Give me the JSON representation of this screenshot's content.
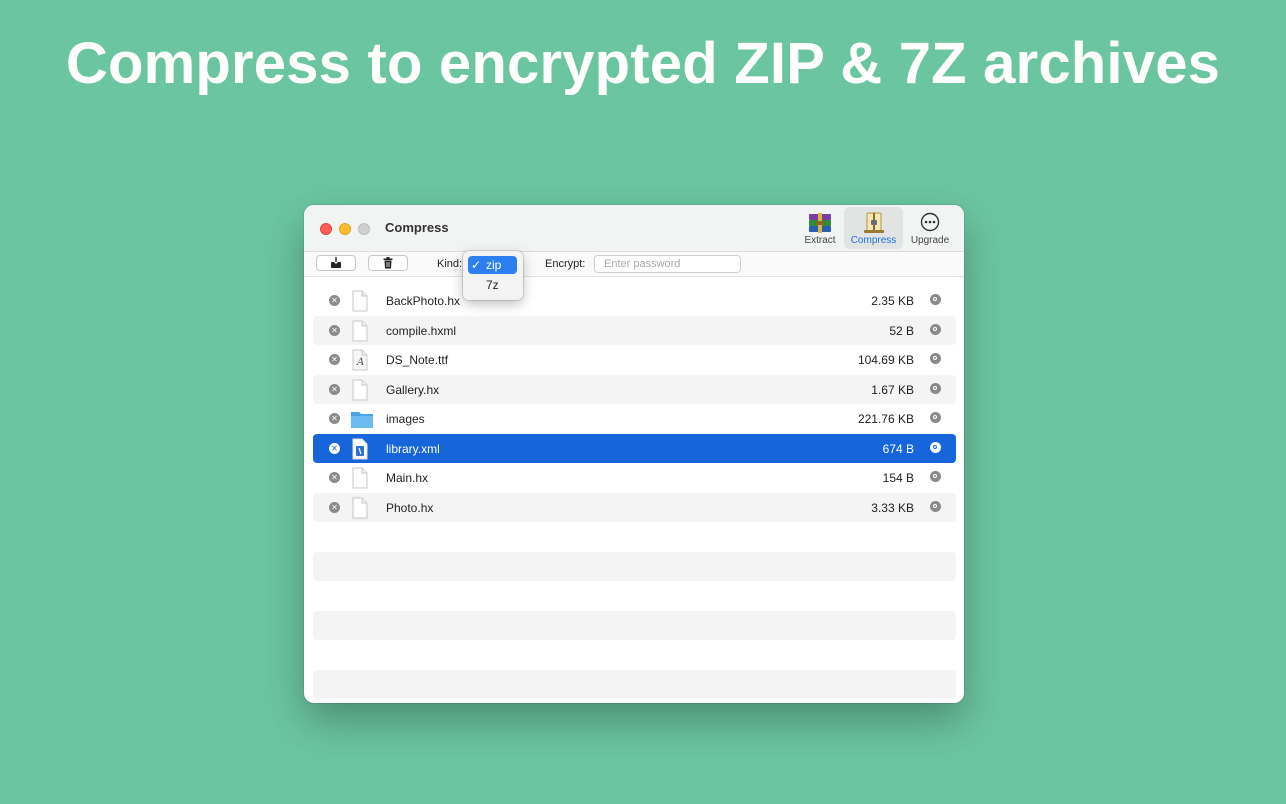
{
  "headline": "Compress to encrypted ZIP & 7Z archives",
  "window": {
    "title": "Compress",
    "toolbar": [
      {
        "label": "Extract",
        "icon": "archive-stack-icon"
      },
      {
        "label": "Compress",
        "icon": "zipper-archive-icon",
        "active": true
      },
      {
        "label": "Upgrade",
        "icon": "ellipsis-circle-icon"
      }
    ]
  },
  "controls": {
    "add_icon": "download-tray-icon",
    "trash_icon": "trash-icon",
    "kind_label": "Kind:",
    "kind_options": [
      "zip",
      "7z"
    ],
    "kind_selected": "zip",
    "check_mark": "✓",
    "encrypt_label": "Encrypt:",
    "password_placeholder": "Enter password",
    "password_value": ""
  },
  "files": [
    {
      "name": "BackPhoto.hx",
      "size": "2.35 KB",
      "icon": "document-icon"
    },
    {
      "name": "compile.hxml",
      "size": "52 B",
      "icon": "document-icon"
    },
    {
      "name": "DS_Note.ttf",
      "size": "104.69 KB",
      "icon": "font-file-icon"
    },
    {
      "name": "Gallery.hx",
      "size": "1.67 KB",
      "icon": "document-icon"
    },
    {
      "name": "images",
      "size": "221.76 KB",
      "icon": "folder-icon"
    },
    {
      "name": "library.xml",
      "size": "674 B",
      "icon": "xml-file-icon",
      "selected": true
    },
    {
      "name": "Main.hx",
      "size": "154 B",
      "icon": "document-icon"
    },
    {
      "name": "Photo.hx",
      "size": "3.33 KB",
      "icon": "document-icon"
    }
  ],
  "colors": {
    "background": "#6bc5a0",
    "selection": "#1665da",
    "accent": "#2d7ff0"
  }
}
